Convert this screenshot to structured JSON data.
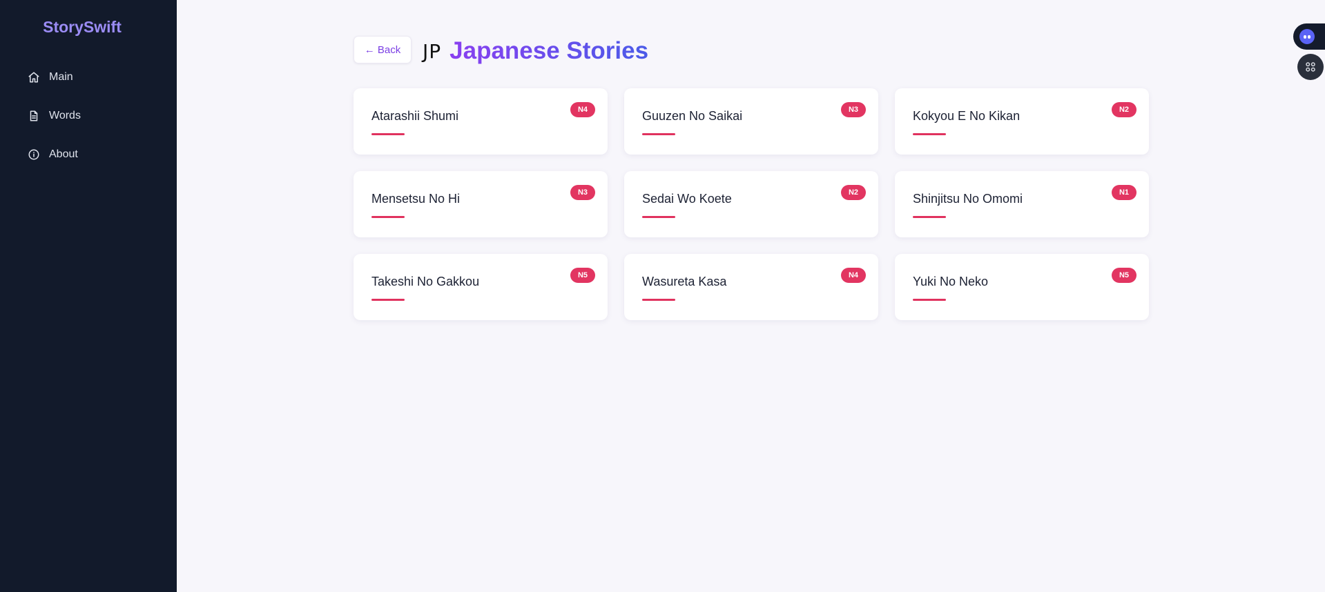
{
  "app": {
    "brand": "StorySwift"
  },
  "sidebar": {
    "items": [
      {
        "label": "Main",
        "icon": "home-icon"
      },
      {
        "label": "Words",
        "icon": "document-icon"
      },
      {
        "label": "About",
        "icon": "info-icon"
      }
    ]
  },
  "header": {
    "back_label": "← Back",
    "flag_code": "JP",
    "title": "Japanese Stories"
  },
  "stories": [
    {
      "title": "Atarashii Shumi",
      "level": "N4"
    },
    {
      "title": "Guuzen No Saikai",
      "level": "N3"
    },
    {
      "title": "Kokyou E No Kikan",
      "level": "N2"
    },
    {
      "title": "Mensetsu No Hi",
      "level": "N3"
    },
    {
      "title": "Sedai Wo Koete",
      "level": "N2"
    },
    {
      "title": "Shinjitsu No Omomi",
      "level": "N1"
    },
    {
      "title": "Takeshi No Gakkou",
      "level": "N5"
    },
    {
      "title": "Wasureta Kasa",
      "level": "N4"
    },
    {
      "title": "Yuki No Neko",
      "level": "N5"
    }
  ],
  "colors": {
    "sidebar_bg": "#121a2b",
    "brand": "#9b8cf5",
    "accent": "#e23561",
    "title_gradient_start": "#8a3ff0",
    "title_gradient_end": "#4b5be8"
  },
  "widgets": {
    "assistant_icon": "robot-face-icon",
    "apps_icon": "grid-apps-icon"
  }
}
